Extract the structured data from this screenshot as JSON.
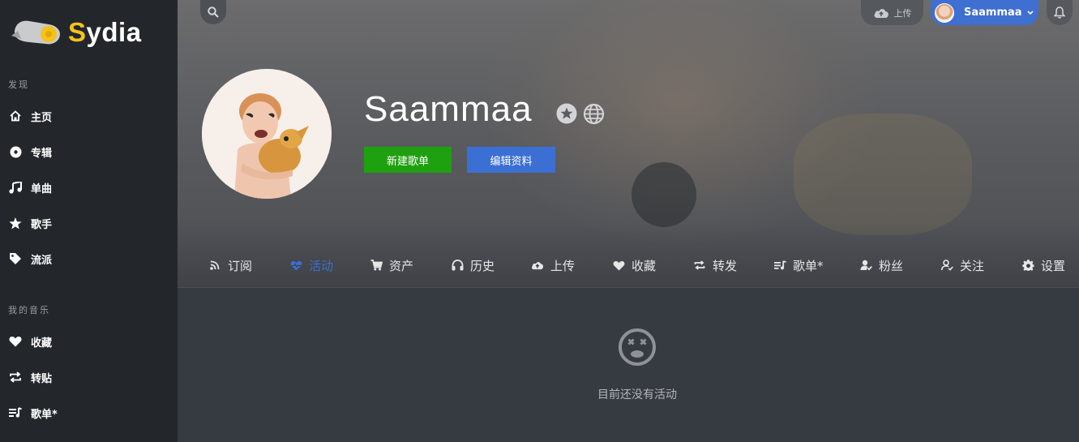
{
  "app": {
    "logo_text_s": "S",
    "logo_text_rest": "ydia",
    "brand_color": "#f5c218"
  },
  "sidebar": {
    "discover_title": "发现",
    "discover_items": [
      {
        "label": "主页",
        "icon": "home-icon"
      },
      {
        "label": "专辑",
        "icon": "disc-icon"
      },
      {
        "label": "单曲",
        "icon": "music-note-icon"
      },
      {
        "label": "歌手",
        "icon": "star-icon"
      },
      {
        "label": "流派",
        "icon": "tag-icon"
      }
    ],
    "mymusic_title": "我的音乐",
    "mymusic_items": [
      {
        "label": "收藏",
        "icon": "heart-icon"
      },
      {
        "label": "转贴",
        "icon": "repost-icon"
      },
      {
        "label": "歌单*",
        "icon": "playlist-icon"
      }
    ]
  },
  "topbar": {
    "upload_label": "上传",
    "username": "Saammaa"
  },
  "profile": {
    "name": "Saammaa",
    "new_playlist_label": "新建歌单",
    "edit_profile_label": "编辑资料"
  },
  "tabs": [
    {
      "label": "订阅",
      "icon": "rss-icon",
      "active": false
    },
    {
      "label": "活动",
      "icon": "heart-pulse-icon",
      "active": true
    },
    {
      "label": "资产",
      "icon": "cart-icon",
      "active": false
    },
    {
      "label": "历史",
      "icon": "headphones-icon",
      "active": false
    },
    {
      "label": "上传",
      "icon": "cloud-upload-icon",
      "active": false
    },
    {
      "label": "收藏",
      "icon": "heart-icon",
      "active": false
    },
    {
      "label": "转发",
      "icon": "repost-icon",
      "active": false
    },
    {
      "label": "歌单*",
      "icon": "playlist-icon",
      "active": false
    },
    {
      "label": "粉丝",
      "icon": "user-check-icon",
      "active": false
    },
    {
      "label": "关注",
      "icon": "user-follow-icon",
      "active": false
    },
    {
      "label": "设置",
      "icon": "gear-icon",
      "active": false
    }
  ],
  "empty_state": {
    "message": "目前还没有活动",
    "icon": "dizzy-face-icon"
  },
  "colors": {
    "accent_blue": "#3b6fd3",
    "accent_green": "#1fa010",
    "sidebar_bg": "#23272b",
    "content_bg": "#363a41"
  }
}
